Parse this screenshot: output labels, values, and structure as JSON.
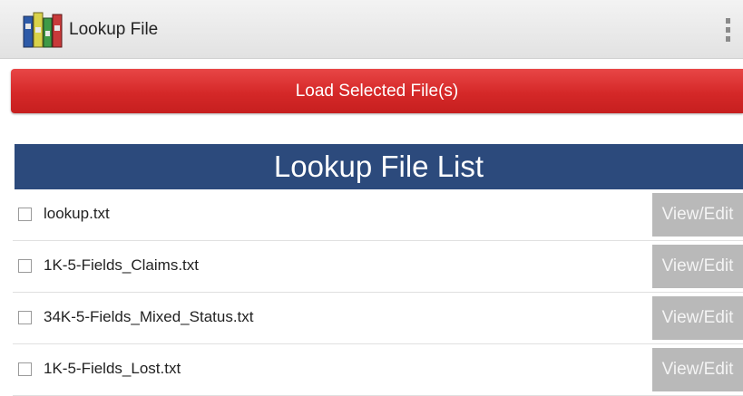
{
  "action_bar": {
    "title": "Lookup File",
    "app_icon": "books-icon",
    "overflow_icon": "overflow-menu-icon",
    "colors": {
      "background": "#e8e8e8"
    }
  },
  "load_button": {
    "label": "Load Selected File(s)",
    "color": "#d52828"
  },
  "list": {
    "header": "Lookup File List",
    "header_color": "#2c4a7c",
    "items": [
      {
        "filename": "lookup.txt",
        "checked": false,
        "action_label": "View/Edit"
      },
      {
        "filename": "1K-5-Fields_Claims.txt",
        "checked": false,
        "action_label": "View/Edit"
      },
      {
        "filename": "34K-5-Fields_Mixed_Status.txt",
        "checked": false,
        "action_label": "View/Edit"
      },
      {
        "filename": "1K-5-Fields_Lost.txt",
        "checked": false,
        "action_label": "View/Edit"
      }
    ]
  }
}
